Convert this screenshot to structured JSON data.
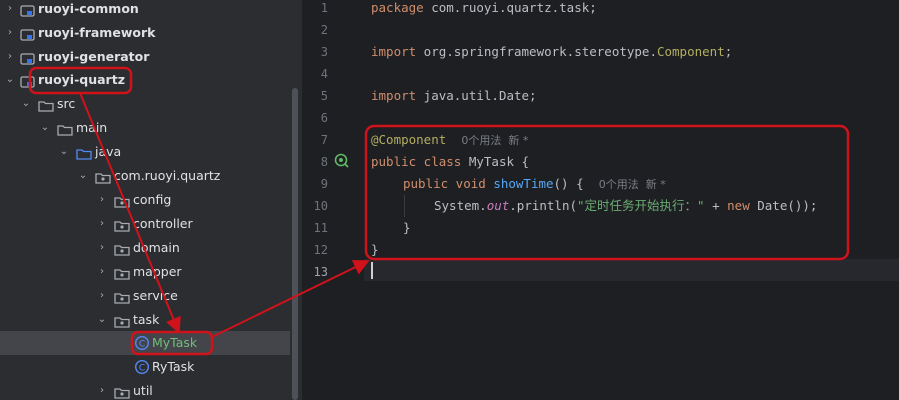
{
  "tree": {
    "items": [
      {
        "label": "ruoyi-common",
        "bold": true
      },
      {
        "label": "ruoyi-framework",
        "bold": true
      },
      {
        "label": "ruoyi-generator",
        "bold": true
      },
      {
        "label": "ruoyi-quartz",
        "bold": true
      },
      {
        "label": "src"
      },
      {
        "label": "main"
      },
      {
        "label": "java"
      },
      {
        "label": "com.ruoyi.quartz"
      },
      {
        "label": "config"
      },
      {
        "label": "controller"
      },
      {
        "label": "domain"
      },
      {
        "label": "mapper"
      },
      {
        "label": "service"
      },
      {
        "label": "task"
      },
      {
        "label": "MyTask"
      },
      {
        "label": "RyTask"
      },
      {
        "label": "util"
      }
    ],
    "arrow_collapsed": "›",
    "arrow_expanded": "⌄"
  },
  "editor": {
    "line_numbers": [
      "1",
      "2",
      "3",
      "4",
      "5",
      "6",
      "7",
      "8",
      "9",
      "10",
      "11",
      "12",
      "13"
    ],
    "code": {
      "l1_kw": "package",
      "l1_rest": " com.ruoyi.quartz.task;",
      "l3_kw": "import",
      "l3_rest": " org.springframework.stereotype.",
      "l3_cls": "Component",
      "l3_end": ";",
      "l5_kw": "import",
      "l5_rest": " java.util.Date;",
      "l7_ann": "@Component",
      "l7_hint": "0个用法  新 *",
      "l8_kw": "public class",
      "l8_name": " MyTask {",
      "l9_kw": "public void",
      "l9_fn": " showTime",
      "l9_rest": "() {",
      "l9_hint": "0个用法  新 *",
      "l10_a": "System.",
      "l10_field": "out",
      "l10_b": ".println(",
      "l10_str": "\"定时任务开始执行：\"",
      "l10_c": " + ",
      "l10_kw": "new",
      "l10_d": " Date());",
      "l11": "}",
      "l12": "}"
    }
  },
  "annotation_color": "#d0121b"
}
